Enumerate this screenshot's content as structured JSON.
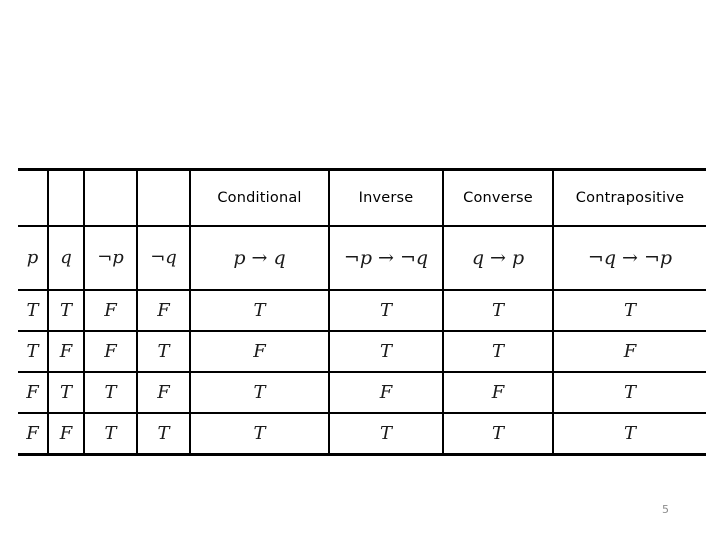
{
  "slide": {
    "page_number": "5"
  },
  "table": {
    "group_headers": [
      {
        "label": "",
        "span": 1
      },
      {
        "label": "",
        "span": 1
      },
      {
        "label": "",
        "span": 1
      },
      {
        "label": "",
        "span": 1
      },
      {
        "label": "Conditional",
        "span": 1
      },
      {
        "label": "Inverse",
        "span": 1
      },
      {
        "label": "Converse",
        "span": 1
      },
      {
        "label": "Contrapositive",
        "span": 1
      }
    ],
    "formula_headers": [
      "p",
      "q",
      "¬p",
      "¬q",
      "p → q",
      "¬p → ¬q",
      "q → p",
      "¬q → ¬p"
    ],
    "rows": [
      [
        "T",
        "T",
        "F",
        "F",
        "T",
        "T",
        "T",
        "T"
      ],
      [
        "T",
        "F",
        "F",
        "T",
        "F",
        "T",
        "T",
        "F"
      ],
      [
        "F",
        "T",
        "T",
        "F",
        "T",
        "F",
        "F",
        "T"
      ],
      [
        "F",
        "F",
        "T",
        "T",
        "T",
        "T",
        "T",
        "T"
      ]
    ],
    "colors": {
      "rule": "#000000",
      "text": "#1a1a1a",
      "background": "#ffffff",
      "page_number": "#8c8c8c"
    }
  }
}
